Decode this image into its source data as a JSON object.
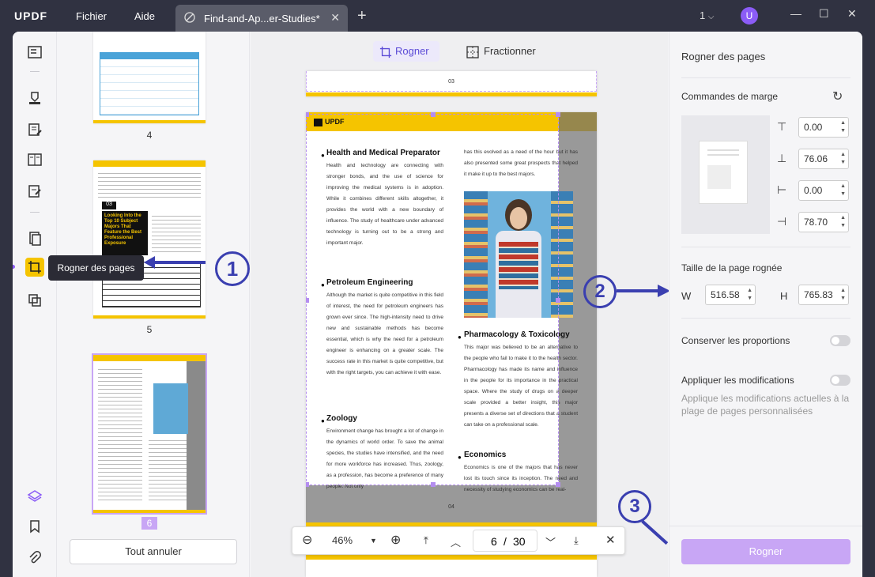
{
  "app": {
    "logo": "UPDF",
    "menu": [
      "Fichier",
      "Aide"
    ],
    "tab_title": "Find-and-Ap...er-Studies*",
    "page_indicator": "1",
    "avatar_initial": "U"
  },
  "tooltip": "Rogner des pages",
  "thumbnails": [
    {
      "label": "4"
    },
    {
      "label": "5"
    },
    {
      "label": "6"
    }
  ],
  "thumb5_heading": "Looking Into the Top 10 Subject Majors That Feature the Best Professional Exposure",
  "thumb5_num": "03",
  "cancel_all": "Tout annuler",
  "modes": {
    "crop": "Rogner",
    "split": "Fractionner"
  },
  "document": {
    "page3_footer": "03",
    "page4_footer": "04",
    "brand": "UPDF",
    "sections": [
      {
        "title": "Health and Medical Preparator",
        "text": "Health and technology are connecting with stronger bonds, and the use of science for improving the medical systems is in adoption. While it combines different skills altogether, it provides the world with a new boundary of influence. The study of healthcare under advanced technology is turning out to be a strong and important major."
      },
      {
        "title": "Petroleum Engineering",
        "text": "Although the market is quite competitive in this field of interest, the need for petroleum engineers has grown ever since. The high-intensity need to drive new and sustainable methods has become essential, which is why the need for a petroleum engineer is enhancing on a greater scale. The success rate in this market is quite competitive, but with the right targets, you can achieve it with ease."
      },
      {
        "title": "Zoology",
        "text": "Environment change has brought a lot of change in the dynamics of world order. To save the animal species, the studies have intensified, and the need for more workforce has increased. Thus, zoology, as a profession, has become a preference of many people. Not only"
      },
      {
        "title": "Pharmacology & Toxicology",
        "text": "This major was believed to be an alternative to the people who fail to make it to the health sector. Pharmacology has made its name and influence in the people for its importance in the practical space. Where the study of drugs on a deeper scale provided a better insight, this major presents a diverse set of directions that a student can take on a professional scale."
      },
      {
        "title": "Economics",
        "text": "Economics is one of the majors that has never lost its touch since its inception. The need and necessity of studying economics can be real-"
      }
    ],
    "col2_top": "has this evolved as a need of the hour but it has also presented some great prospects that helped it make it up to the best majors."
  },
  "toolbar": {
    "zoom": "46%",
    "current_page": "6",
    "separator": "/",
    "total_pages": "30"
  },
  "panel": {
    "title": "Rogner des pages",
    "margin_label": "Commandes de marge",
    "margins": [
      "0.00",
      "76.06",
      "0.00",
      "78.70"
    ],
    "size_label": "Taille de la page rognée",
    "w_label": "W",
    "w_value": "516.58",
    "h_label": "H",
    "h_value": "765.83",
    "keep_ratio": "Conserver les proportions",
    "apply_label": "Appliquer les modifications",
    "apply_desc": "Applique les modifications actuelles à la plage de pages personnalisées",
    "crop_button": "Rogner"
  },
  "annotations": [
    "1",
    "2",
    "3"
  ],
  "colors": {
    "accent": "#f5c400",
    "brand": "#8b5cf6",
    "crop_button": "#c8a6f5",
    "annotation": "#3a3fb0"
  }
}
